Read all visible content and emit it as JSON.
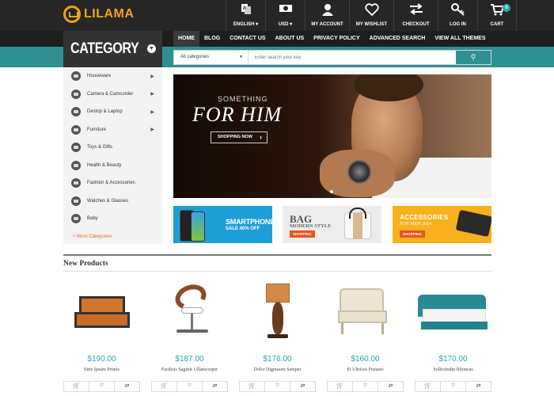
{
  "brand": {
    "logo_text": "LILAMA"
  },
  "toolbar": {
    "language": "ENGLISH ▾",
    "currency": "USD ▾",
    "my_account": "MY ACCOUNT",
    "my_wishlist": "MY WISHLIST",
    "checkout": "CHECKOUT",
    "log_in": "LOG IN",
    "cart": "CART",
    "cart_count": "0"
  },
  "nav": {
    "items": [
      "HOME",
      "BLOG",
      "CONTACT US",
      "ABOUT US",
      "PRIVACY POLICY",
      "ADVANCED SEARCH",
      "VIEW ALL THEMES"
    ],
    "active": "HOME"
  },
  "category": {
    "title": "CATEGORY",
    "items": [
      {
        "label": "Houseware",
        "has_sub": true
      },
      {
        "label": "Camera & Camcorder",
        "has_sub": true
      },
      {
        "label": "Destop & Laptop",
        "has_sub": true
      },
      {
        "label": "Furniture",
        "has_sub": true
      },
      {
        "label": "Toys & Gifts",
        "has_sub": false
      },
      {
        "label": "Health & Beauty",
        "has_sub": false
      },
      {
        "label": "Fashion & Accessories",
        "has_sub": false
      },
      {
        "label": "Watches & Glasses",
        "has_sub": false
      },
      {
        "label": "Baby",
        "has_sub": false
      }
    ],
    "more": "+ More Categories"
  },
  "search": {
    "category_value": "All categories",
    "placeholder": "Enter search your key"
  },
  "hero": {
    "subtitle": "SOMETHING",
    "title": "FOR HIM",
    "button": "SHOPPING NOW"
  },
  "banners": {
    "smartphone": {
      "title": "SMARTPHONE",
      "subtitle": "SALE 40% OFF"
    },
    "bag": {
      "title": "BAG",
      "subtitle": "MODERN STYLE",
      "button": "SHOPPING"
    },
    "accessories": {
      "title": "ACCESSORIES",
      "subtitle": "FOR MEN 2014",
      "button": "SHOPPING"
    }
  },
  "new_products": {
    "title": "New Products",
    "items": [
      {
        "price": "$190.00",
        "name": "Sirte Ipsum Primis"
      },
      {
        "price": "$187.00",
        "name": "Facilisis Sagittis Ullamcorper"
      },
      {
        "price": "$176.00",
        "name": "Dolor Dignissim Semper"
      },
      {
        "price": "$160.00",
        "name": "Et Ultrices Posuere"
      },
      {
        "price": "$170.00",
        "name": "Sollicitudin Rhoncus"
      }
    ]
  },
  "colors": {
    "accent": "#2e8f95",
    "brand": "#f3a21d",
    "price": "#2aa6b1",
    "more_link": "#f26b21"
  }
}
